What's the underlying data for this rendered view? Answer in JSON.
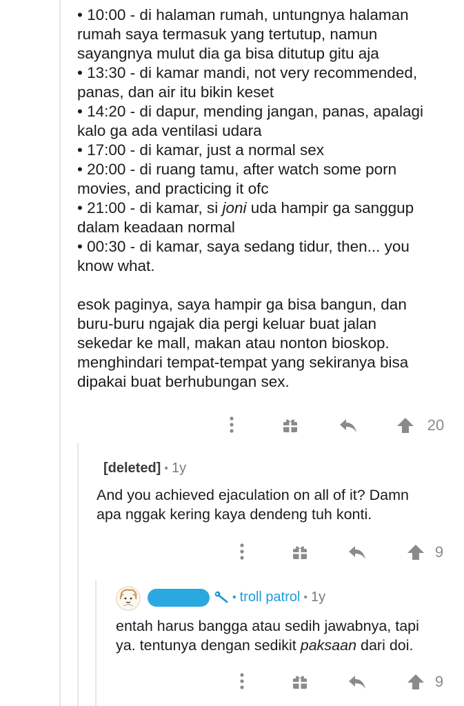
{
  "comment_main": {
    "list_items": [
      [
        "• 10:00 - di halaman rumah, untungnya halaman",
        "rumah saya termasuk yang tertutup, namun",
        "sayangnya mulut dia ga bisa ditutup gitu aja"
      ],
      [
        "• 13:30 - di kamar mandi, not very recommended,",
        "panas, dan air itu bikin keset"
      ],
      [
        "• 14:20 - di dapur, mending jangan, panas, apalagi",
        "kalo ga ada ventilasi udara"
      ],
      [
        "• 17:00 - di kamar, just a normal sex"
      ],
      [
        "• 20:00 - di ruang tamu, after watch some porn",
        "movies, and practicing it ofc"
      ],
      [
        "• 00:30 - di kamar, saya sedang tidur, then... you",
        "know what."
      ]
    ],
    "item_2100": {
      "prefix": "• 21:00 - di kamar, si ",
      "emphasis": "joni",
      "suffix": " uda hampir ga sanggup",
      "line2": "dalam keadaan normal"
    },
    "paragraph_lines": [
      "esok paginya, saya hampir ga bisa bangun, dan",
      "buru-buru ngajak dia pergi keluar buat jalan",
      "sekedar ke mall, makan atau nonton bioskop.",
      "menghindari tempat-tempat yang sekiranya bisa",
      "dipakai buat berhubungan sex."
    ],
    "score": "20"
  },
  "reply_1": {
    "author": "[deleted]",
    "separator": "•",
    "age": "1y",
    "body_lines": [
      "And you achieved ejaculation on all of it? Damn",
      "apa nggak kering kaya dendeng tuh konti."
    ],
    "score": "9"
  },
  "reply_2": {
    "separator": "•",
    "flair": "troll patrol",
    "age": "1y",
    "body_line1": "entah harus bangga atau sedih jawabnya, tapi",
    "body_line2_prefix": "ya. tentunya dengan sedikit ",
    "body_line2_emphasis": "paksaan",
    "body_line2_suffix": " dari doi.",
    "score": "9"
  },
  "icons": {
    "more": "more-vertical-icon",
    "award": "gift-award-icon",
    "reply": "reply-arrow-icon",
    "upvote": "upvote-arrow-icon",
    "mod": "wrench-mod-icon"
  },
  "colors": {
    "text": "#1c1c1c",
    "muted": "#8a8a8a",
    "flair": "#1f9bd7",
    "redaction": "#2aa9e0"
  }
}
